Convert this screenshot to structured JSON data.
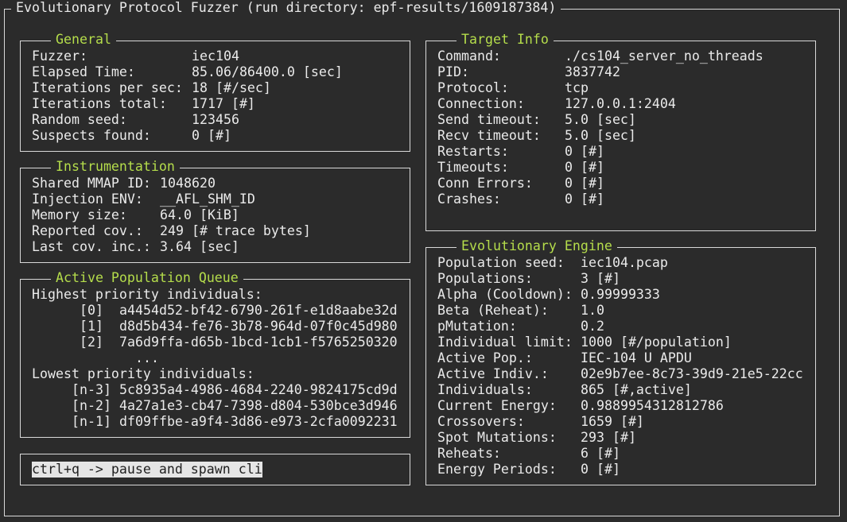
{
  "app": {
    "title": "Evolutionary Protocol Fuzzer (run directory: epf-results/1609187384)"
  },
  "general": {
    "title": "General",
    "rows": [
      {
        "label": "Fuzzer:",
        "value": "iec104"
      },
      {
        "label": "Elapsed Time:",
        "value": "85.06/86400.0 [sec]"
      },
      {
        "label": "Iterations per sec:",
        "value": "18 [#/sec]"
      },
      {
        "label": "Iterations total:",
        "value": "1717 [#]"
      },
      {
        "label": "Random seed:",
        "value": "123456"
      },
      {
        "label": "Suspects found:",
        "value": "0 [#]"
      }
    ]
  },
  "instrumentation": {
    "title": "Instrumentation",
    "rows": [
      {
        "label": "Shared MMAP ID:",
        "value": "1048620"
      },
      {
        "label": "Injection ENV:",
        "value": "__AFL_SHM_ID"
      },
      {
        "label": "Memory size:",
        "value": "64.0 [KiB]"
      },
      {
        "label": "Reported cov.:",
        "value": "249 [# trace bytes]"
      },
      {
        "label": "Last cov. inc.:",
        "value": "3.64 [sec]"
      }
    ]
  },
  "population_queue": {
    "title": "Active Population Queue",
    "highest_label": "Highest priority individuals:",
    "highest": [
      {
        "index": "[0]",
        "id": "a4454d52-bf42-6790-261f-e1d8aabe32d"
      },
      {
        "index": "[1]",
        "id": "d8d5b434-fe76-3b78-964d-07f0c45d980"
      },
      {
        "index": "[2]",
        "id": "7a6d9ffa-d65b-1bcd-1cb1-f5765250320"
      }
    ],
    "ellipsis": "...",
    "lowest_label": "Lowest priority individuals:",
    "lowest": [
      {
        "index": "[n-3]",
        "id": "5c8935a4-4986-4684-2240-9824175cd9d"
      },
      {
        "index": "[n-2]",
        "id": "4a27a1e3-cb47-7398-d804-530bce3d946"
      },
      {
        "index": "[n-1]",
        "id": "df09ffbe-a9f4-3d86-e973-2cfa0092231"
      }
    ]
  },
  "command_box": {
    "text": "ctrl+q -> pause and spawn cli"
  },
  "target_info": {
    "title": "Target Info",
    "rows": [
      {
        "label": "Command:",
        "value": "./cs104_server_no_threads"
      },
      {
        "label": "PID:",
        "value": "3837742"
      },
      {
        "label": "Protocol:",
        "value": "tcp"
      },
      {
        "label": "Connection:",
        "value": "127.0.0.1:2404"
      },
      {
        "label": "Send timeout:",
        "value": "5.0 [sec]"
      },
      {
        "label": "Recv timeout:",
        "value": "5.0 [sec]"
      },
      {
        "label": "Restarts:",
        "value": "0 [#]"
      },
      {
        "label": "Timeouts:",
        "value": "0 [#]"
      },
      {
        "label": "Conn Errors:",
        "value": "0 [#]"
      },
      {
        "label": "Crashes:",
        "value": "0 [#]"
      }
    ]
  },
  "evolutionary_engine": {
    "title": "Evolutionary Engine",
    "rows": [
      {
        "label": "Population seed:",
        "value": "iec104.pcap"
      },
      {
        "label": "Populations:",
        "value": "3 [#]"
      },
      {
        "label": "Alpha (Cooldown):",
        "value": "0.99999333"
      },
      {
        "label": "Beta (Reheat):",
        "value": "1.0"
      },
      {
        "label": "pMutation:",
        "value": "0.2"
      },
      {
        "label": "Individual limit:",
        "value": "1000 [#/population]"
      },
      {
        "label": "Active Pop.:",
        "value": "IEC-104 U APDU"
      },
      {
        "label": "Active Indiv.:",
        "value": "02e9b7ee-8c73-39d9-21e5-22cc"
      },
      {
        "label": "Individuals:",
        "value": "865 [#,active]"
      },
      {
        "label": "Current Energy:",
        "value": "0.9889954312812786"
      },
      {
        "label": "Crossovers:",
        "value": "1659 [#]"
      },
      {
        "label": "Spot Mutations:",
        "value": "293 [#]"
      },
      {
        "label": "Reheats:",
        "value": "6 [#]"
      },
      {
        "label": "Energy Periods:",
        "value": "0 [#]"
      }
    ]
  },
  "colors": {
    "background": "#2b2b2b",
    "text": "#eaeaea",
    "section_title": "#b5dd4b",
    "border": "#d9d9d9"
  }
}
